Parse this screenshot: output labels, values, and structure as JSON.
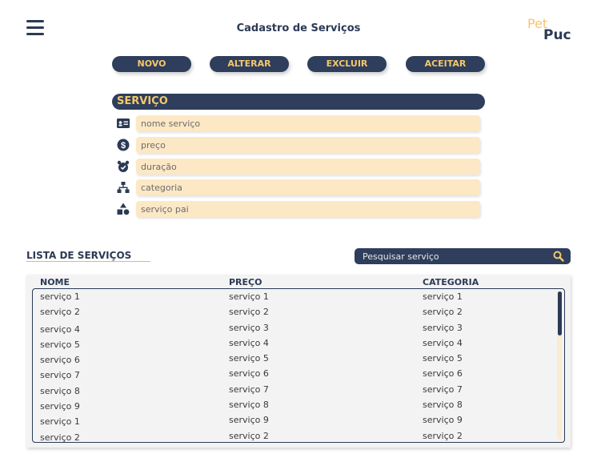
{
  "header": {
    "title": "Cadastro de Serviços",
    "logo_pet": "Pet",
    "logo_puc": "Puc"
  },
  "toolbar": {
    "novo": "NOVO",
    "alterar": "ALTERAR",
    "excluir": "EXCLUIR",
    "aceitar": "ACEITAR"
  },
  "form": {
    "section_title": "SERVIÇO",
    "fields": [
      {
        "icon": "id-card-icon",
        "placeholder": "nome serviço"
      },
      {
        "icon": "dollar-icon",
        "placeholder": "preço"
      },
      {
        "icon": "alarm-clock-icon",
        "placeholder": "duração"
      },
      {
        "icon": "hierarchy-icon",
        "placeholder": "categoria"
      },
      {
        "icon": "shapes-icon",
        "placeholder": "serviço pai"
      }
    ]
  },
  "list": {
    "title": "LISTA DE SERVIÇOS",
    "search_placeholder": "Pesquisar serviço",
    "headers": {
      "nome": "NOME",
      "preco": "PREÇO",
      "categoria": "CATEGORIA"
    },
    "nome": [
      "serviço 1",
      "serviço 2",
      "serviço 4",
      "serviço 5",
      "serviço 6",
      "serviço 7",
      "serviço 8",
      "serviço 9",
      "serviço 1",
      "serviço 2"
    ],
    "preco": [
      "serviço 1",
      "serviço 2",
      "serviço 3",
      "serviço 4",
      "serviço 5",
      "serviço 6",
      "serviço 7",
      "serviço 8",
      "serviço 9",
      "serviço 2"
    ],
    "categoria": [
      "serviço 1",
      "serviço 2",
      "serviço 3",
      "serviço 4",
      "serviço 5",
      "serviço 6",
      "serviço 7",
      "serviço 8",
      "serviço 9",
      "serviço 2"
    ]
  },
  "colors": {
    "navy": "#2e3e5c",
    "accent": "#f5c86a",
    "field_bg": "#fde8c6"
  }
}
